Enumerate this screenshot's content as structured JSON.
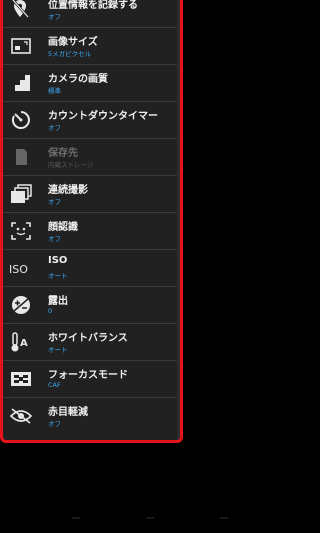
{
  "items": [
    {
      "title": "位置情報を記録する",
      "value": "オフ",
      "icon": "location-off-icon"
    },
    {
      "title": "画像サイズ",
      "value": "5メガピクセル",
      "icon": "image-size-icon"
    },
    {
      "title": "カメラの画質",
      "value": "標準",
      "icon": "quality-icon"
    },
    {
      "title": "カウントダウンタイマー",
      "value": "オフ",
      "icon": "timer-icon"
    },
    {
      "title": "保存先",
      "value": "内蔵ストレージ",
      "icon": "storage-icon",
      "disabled": true
    },
    {
      "title": "連続撮影",
      "value": "オフ",
      "icon": "burst-icon"
    },
    {
      "title": "顔認識",
      "value": "オフ",
      "icon": "face-detect-icon"
    },
    {
      "title": "ISO",
      "value": "オート",
      "icon": "iso-icon"
    },
    {
      "title": "露出",
      "value": "0",
      "icon": "exposure-icon"
    },
    {
      "title": "ホワイトバランス",
      "value": "オート",
      "icon": "white-balance-icon"
    },
    {
      "title": "フォーカスモード",
      "value": "CAF",
      "icon": "focus-mode-icon"
    },
    {
      "title": "赤目軽減",
      "value": "オフ",
      "icon": "red-eye-icon"
    }
  ],
  "colors": {
    "accent": "#3fa9f5",
    "highlight_border": "#e5141b",
    "panel": "#212121"
  }
}
